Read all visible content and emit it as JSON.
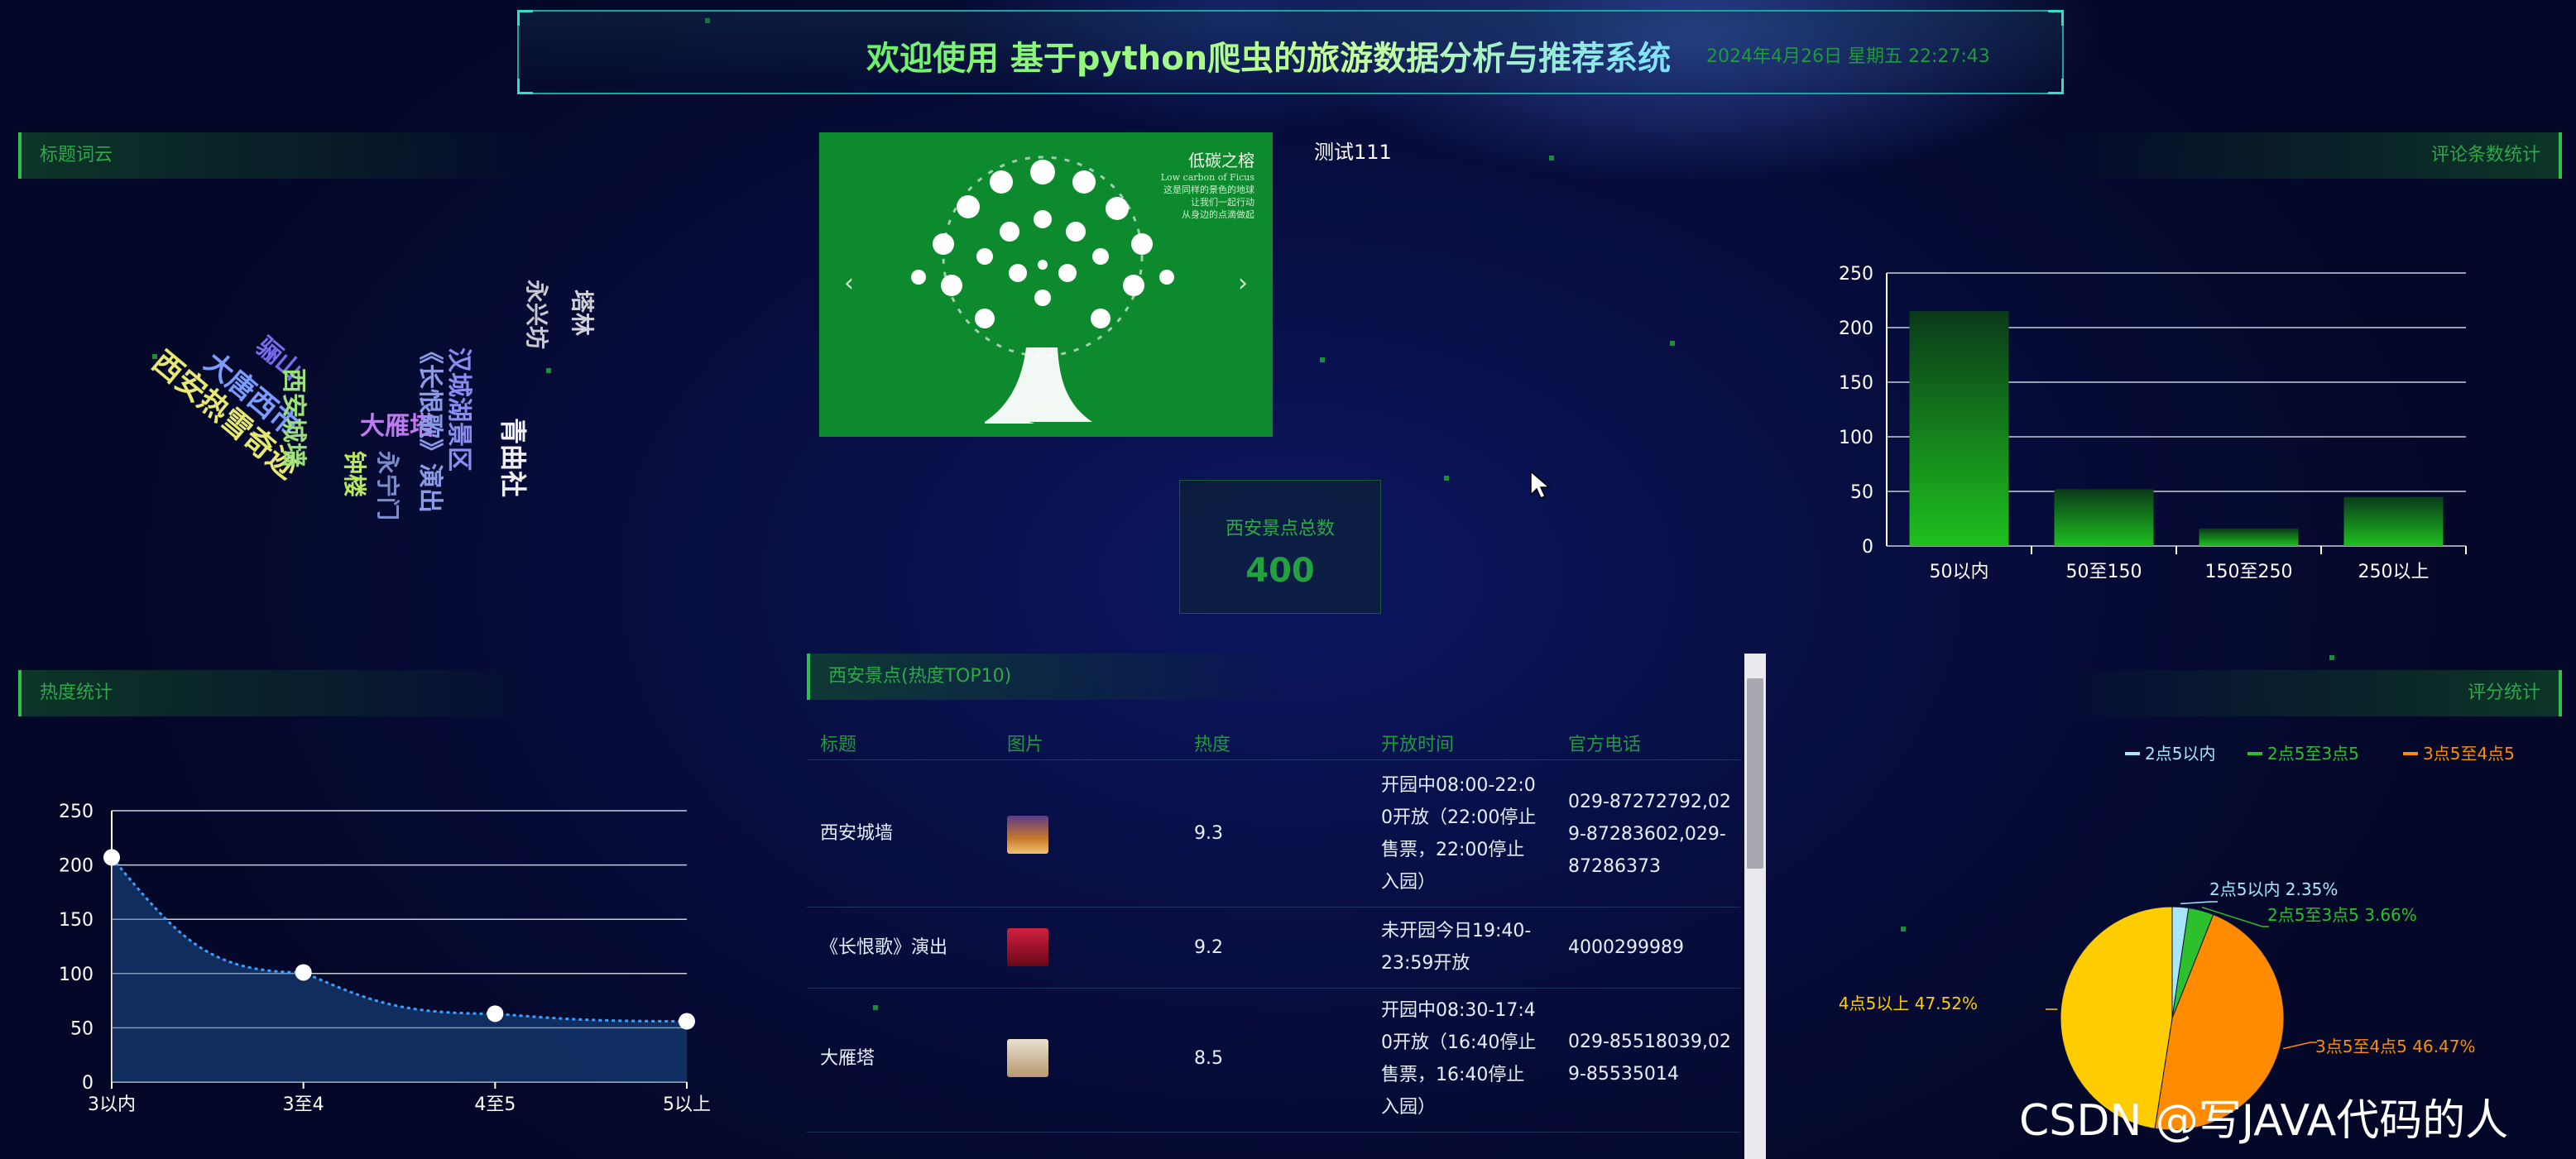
{
  "header": {
    "title": "欢迎使用 基于python爬虫的旅游数据分析与推荐系统",
    "datetime": "2024年4月26日 星期五 22:27:43"
  },
  "panels": {
    "wordcloud_title": "标题词云",
    "comments_title": "评论条数统计",
    "heat_title": "热度统计",
    "score_title": "评分统计",
    "table_title": "西安景点(热度TOP10)"
  },
  "wordcloud": [
    {
      "text": "西安热雪奇迹",
      "color": "#e6e870"
    },
    {
      "text": "大唐西市",
      "color": "#7a9cff"
    },
    {
      "text": "骊山",
      "color": "#7a6cf0"
    },
    {
      "text": "西安城墙",
      "color": "#9ce07a"
    },
    {
      "text": "大雁塔",
      "color": "#c07af0"
    },
    {
      "text": "钟楼",
      "color": "#b8e860"
    },
    {
      "text": "永宁门",
      "color": "#7a8ccc"
    },
    {
      "text": "《长恨歌》演出",
      "color": "#8a9ae6"
    },
    {
      "text": "汉城湖景区",
      "color": "#8a8cf0"
    },
    {
      "text": "青曲社",
      "color": "#f0f0f0"
    },
    {
      "text": "永兴坊",
      "color": "#c8c8d0"
    },
    {
      "text": "塔林",
      "color": "#d0d0d8"
    }
  ],
  "carousel": {
    "caption_title": "低碳之榕",
    "caption_sub": "Low carbon of Ficus",
    "caption_lines": [
      "这是同样的景色的地球",
      "让我们一起行动",
      "从身边的点滴做起"
    ],
    "prev": "‹",
    "next": "›"
  },
  "test_label": "测试111",
  "total": {
    "label": "西安景点总数",
    "value": "400"
  },
  "table": {
    "headers": [
      "标题",
      "图片",
      "热度",
      "开放时间",
      "官方电话"
    ],
    "rows": [
      {
        "title": "西安城墙",
        "heat": "9.3",
        "open": [
          "开园中08:00-22:0",
          "0开放（22:00停止",
          "售票，22:00停止",
          "入园）"
        ],
        "phone": [
          "029-87272792,02",
          "9-87283602,029-",
          "87286373"
        ],
        "thumb": "#c77a2a"
      },
      {
        "title": "《长恨歌》演出",
        "heat": "9.2",
        "open": [
          "未开园今日19:40-",
          "23:59开放"
        ],
        "phone": [
          "4000299989"
        ],
        "thumb": "#b01830"
      },
      {
        "title": "大雁塔",
        "heat": "8.5",
        "open": [
          "开园中08:30-17:4",
          "0开放（16:40停止",
          "售票，16:40停止",
          "入园）"
        ],
        "phone": [
          "029-85518039,02",
          "9-85535014"
        ],
        "thumb": "#c8b08a"
      }
    ]
  },
  "watermark": "CSDN @写JAVA代码的人",
  "chart_data": [
    {
      "type": "bar",
      "title": "评论条数统计",
      "categories": [
        "50以内",
        "50至150",
        "150至250",
        "250以上"
      ],
      "values": [
        215,
        52,
        16,
        45
      ],
      "ylim": [
        0,
        250
      ],
      "yticks": [
        0,
        50,
        100,
        150,
        200,
        250
      ],
      "grid": true,
      "bar_color": "#1ec01e"
    },
    {
      "type": "area",
      "title": "热度统计",
      "categories": [
        "3以内",
        "3至4",
        "4至5",
        "5以上"
      ],
      "values": [
        207,
        101,
        63,
        56
      ],
      "ylim": [
        0,
        250
      ],
      "yticks": [
        0,
        50,
        100,
        150,
        200,
        250
      ],
      "grid": true,
      "line_color": "#3aa0ff"
    },
    {
      "type": "pie",
      "title": "评分统计",
      "legend_position": "top-right",
      "slices": [
        {
          "name": "2点5以内",
          "value": 2.35,
          "label": "2点5以内 2.35%",
          "color": "#a6e7ff"
        },
        {
          "name": "2点5至3点5",
          "value": 3.66,
          "label": "2点5至3点5 3.66%",
          "color": "#2cc02c"
        },
        {
          "name": "3点5至4点5",
          "value": 46.47,
          "label": "3点5至4点5 46.47%",
          "color": "#ff8c00"
        },
        {
          "name": "4点5以上",
          "value": 47.52,
          "label": "4点5以上 47.52%",
          "color": "#ffcc00"
        }
      ]
    }
  ]
}
